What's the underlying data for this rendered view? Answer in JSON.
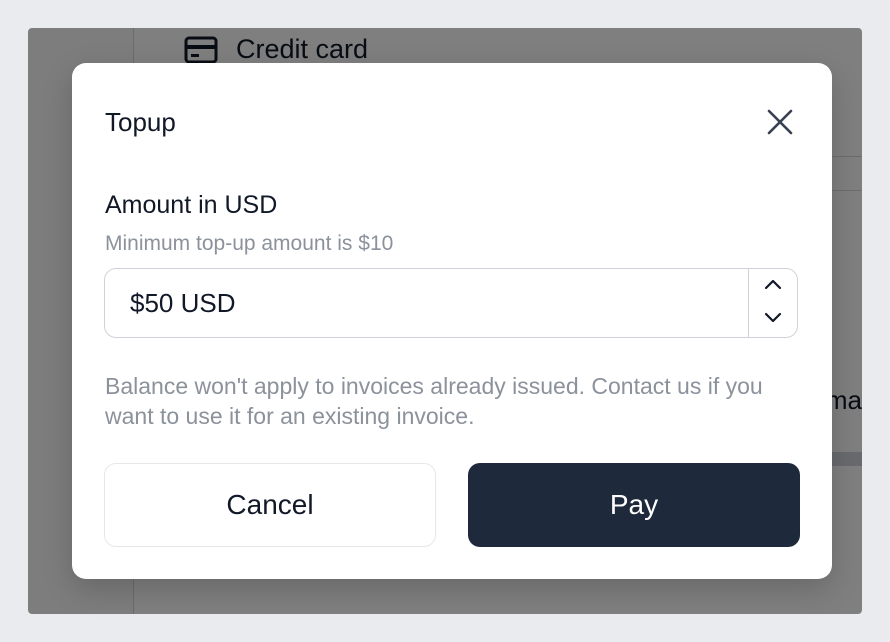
{
  "background": {
    "card_label": "Credit card",
    "card_icon": "credit-card-icon",
    "side_text": "ma"
  },
  "modal": {
    "title": "Topup",
    "close_icon": "close-icon",
    "field_label": "Amount in USD",
    "field_hint": "Minimum top-up amount is $10",
    "amount_value": "$50 USD",
    "stepper_up_icon": "chevron-up-icon",
    "stepper_down_icon": "chevron-down-icon",
    "note": "Balance won't apply to invoices already issued. Contact us if you want to use it for an existing invoice.",
    "cancel_label": "Cancel",
    "pay_label": "Pay"
  },
  "colors": {
    "pay_button": "#1e293b",
    "overlay": "rgba(0,0,0,0.5)",
    "hint_text": "#8b929b"
  }
}
